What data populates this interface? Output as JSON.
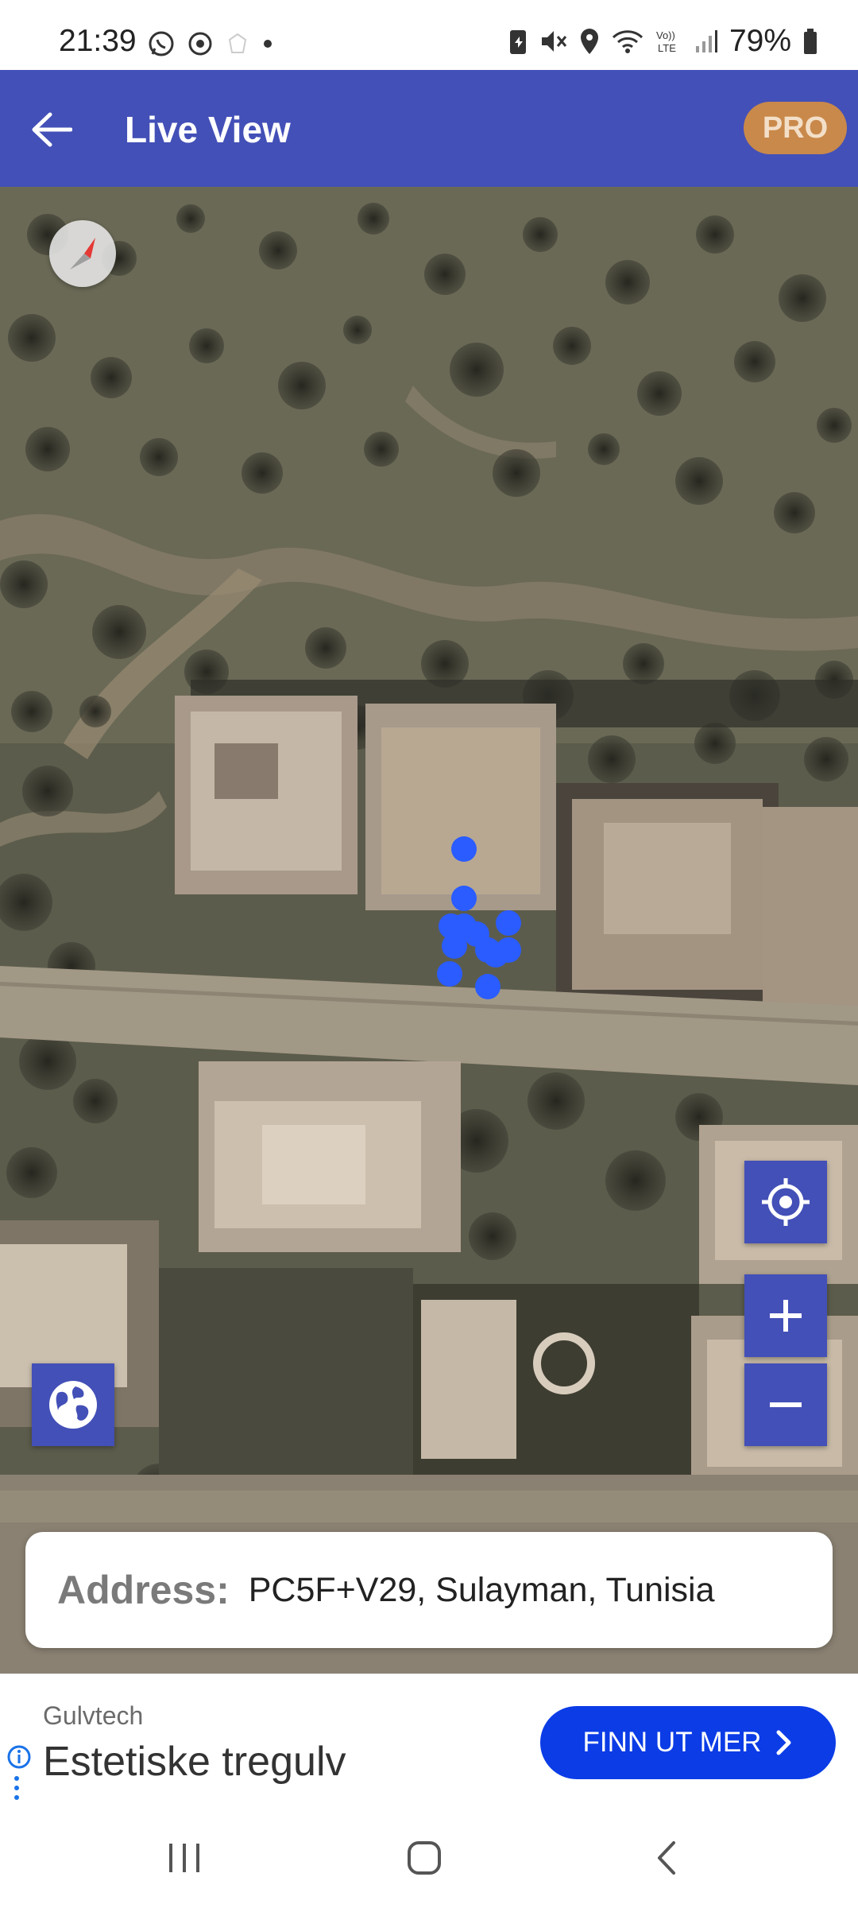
{
  "status_bar": {
    "time": "21:39",
    "battery": "79%",
    "left_icons": [
      "whatsapp-icon",
      "chrome-icon",
      "notification-icon",
      "dot-icon"
    ],
    "right_icons": [
      "battery-saver-icon",
      "mute-icon",
      "location-icon",
      "wifi-icon",
      "volte-icon",
      "signal-icon",
      "battery-icon"
    ]
  },
  "app_bar": {
    "title": "Live View",
    "back_icon": "arrow-left-icon",
    "pro_label": "PRO",
    "background": "#4350b7"
  },
  "map": {
    "type": "satellite",
    "compass_icon": "compass-icon",
    "my_location_icon": "crosshair-icon",
    "zoom_in_label": "+",
    "zoom_out_label": "−",
    "layers_icon": "globe-icon",
    "marker_color": "#2a5cff"
  },
  "address": {
    "label": "Address:",
    "value": "PC5F+V29, Sulayman, Tunisia"
  },
  "ad": {
    "advertiser": "Gulvtech",
    "headline": "Estetiske tregulv",
    "cta_label": "FINN UT MER",
    "cta_color": "#0b3ce6",
    "info_icon": "info-icon"
  },
  "nav_bar": {
    "recents_icon": "recents-icon",
    "home_icon": "home-icon",
    "back_icon": "back-chevron-icon"
  }
}
